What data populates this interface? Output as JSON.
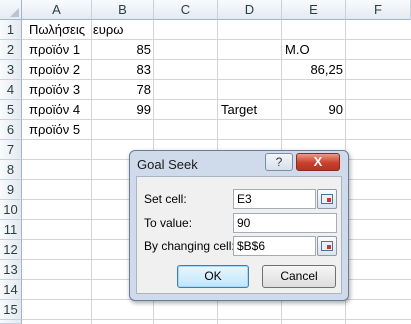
{
  "columns": [
    "A",
    "B",
    "C",
    "D",
    "E",
    "F"
  ],
  "rows": [
    "1",
    "2",
    "3",
    "4",
    "5",
    "6",
    "7",
    "8",
    "9",
    "10",
    "11",
    "12",
    "13",
    "14",
    "15",
    "16"
  ],
  "cells": {
    "A1": "Πωλήσεις",
    "B1": "ευρω",
    "A2": "προϊόν 1",
    "B2": "85",
    "E2": "M.O",
    "A3": "προϊόν 2",
    "B3": "83",
    "E3": "86,25",
    "A4": "προϊόν 3",
    "B4": "78",
    "A5": "προϊόν 4",
    "B5": "99",
    "D5": "Target",
    "E5": "90",
    "A6": "προϊόν 5"
  },
  "dialog": {
    "title": "Goal Seek",
    "help": "?",
    "close": "X",
    "set_cell_label": "Set cell:",
    "set_cell_value": "E3",
    "to_value_label": "To value:",
    "to_value_value": "90",
    "by_changing_label": "By changing cell:",
    "by_changing_value": "$B$6",
    "ok_label": "OK",
    "cancel_label": "Cancel"
  }
}
